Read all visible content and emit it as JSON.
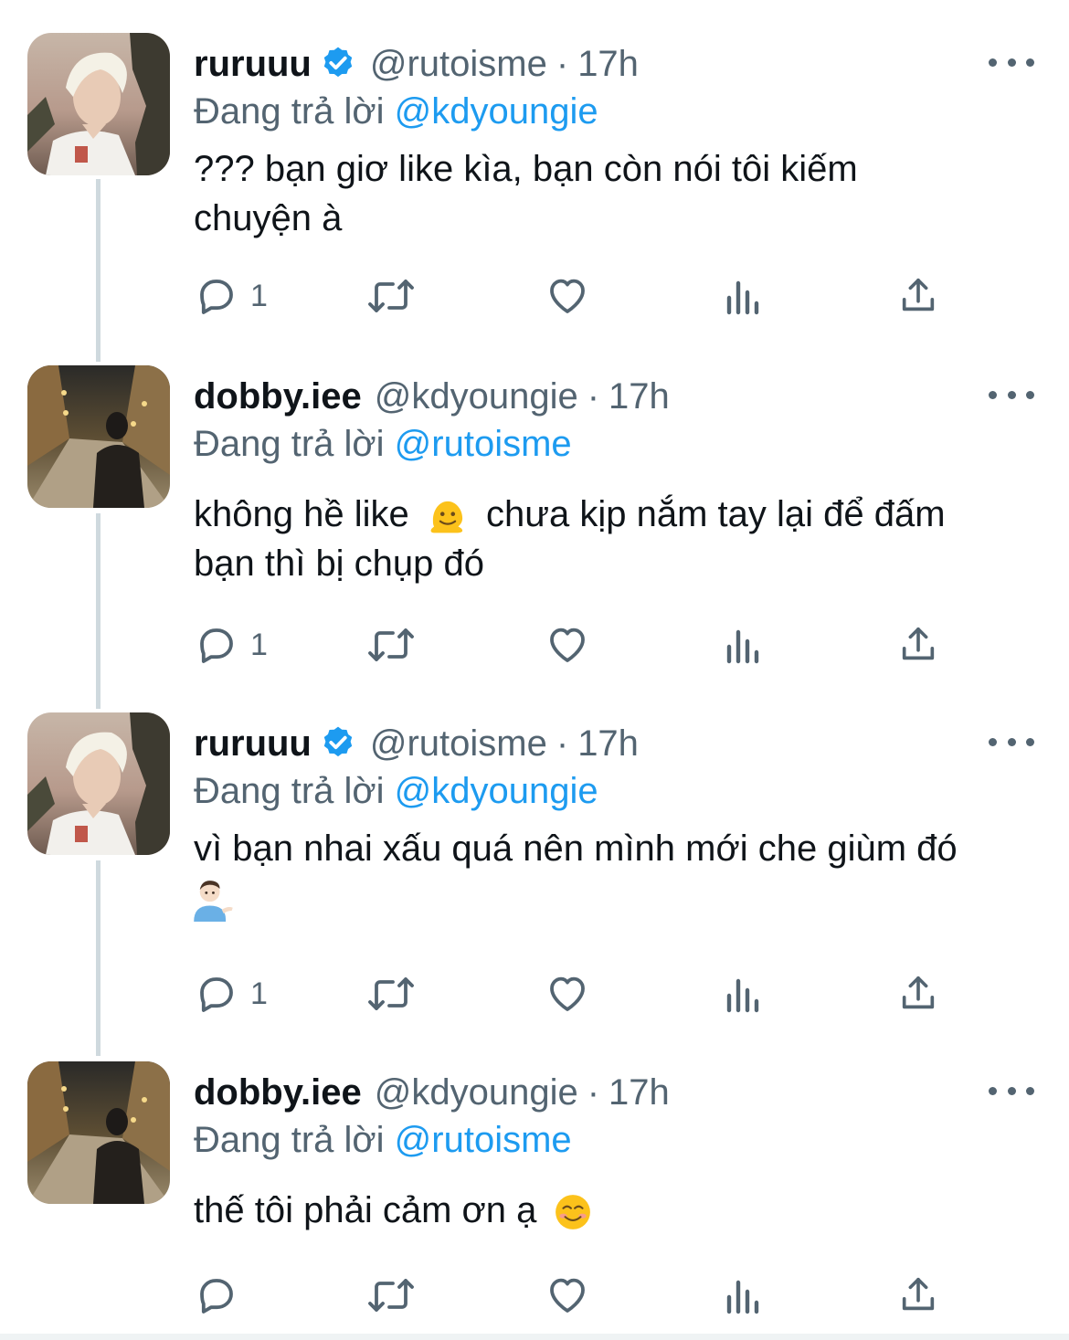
{
  "colors": {
    "accent": "#1d9bf0",
    "secondary": "#536471",
    "text": "#0f1419",
    "thread_line": "#cfd9de"
  },
  "tweets": [
    {
      "name": "ruruuu",
      "verified": true,
      "handle": "@rutoisme",
      "separator": "·",
      "time": "17h",
      "reply_prefix": "Đang trả lời",
      "reply_to": "@kdyoungie",
      "text_lines": [
        "??? bạn giơ like kìa, bạn còn nói tôi kiếm",
        "chuyện à"
      ],
      "reply_count": "1"
    },
    {
      "name": "dobby.iee",
      "verified": false,
      "handle": "@kdyoungie",
      "separator": "·",
      "time": "17h",
      "reply_prefix": "Đang trả lời",
      "reply_to": "@rutoisme",
      "text_line1_before": "không hề like",
      "text_line1_emoji": "melting-face-emoji",
      "text_line1_after": " chưa kịp nắm tay lại để đấm",
      "text_line2": "bạn thì bị chụp đó",
      "reply_count": "1"
    },
    {
      "name": "ruruuu",
      "verified": true,
      "handle": "@rutoisme",
      "separator": "·",
      "time": "17h",
      "reply_prefix": "Đang trả lời",
      "reply_to": "@kdyoungie",
      "text_line1": "vì bạn nhai xấu quá nên mình mới che giùm đó",
      "text_line2_emoji": "man-tipping-hand-emoji",
      "reply_count": "1"
    },
    {
      "name": "dobby.iee",
      "verified": false,
      "handle": "@kdyoungie",
      "separator": "·",
      "time": "17h",
      "reply_prefix": "Đang trả lời",
      "reply_to": "@rutoisme",
      "text_line1_before": "thế tôi phải cảm ơn ạ",
      "text_line1_emoji": "smiling-face-emoji",
      "reply_count": ""
    }
  ],
  "icons": [
    "reply-icon",
    "retweet-icon",
    "like-icon",
    "views-icon",
    "share-icon",
    "more-icon",
    "verified-badge-icon"
  ]
}
